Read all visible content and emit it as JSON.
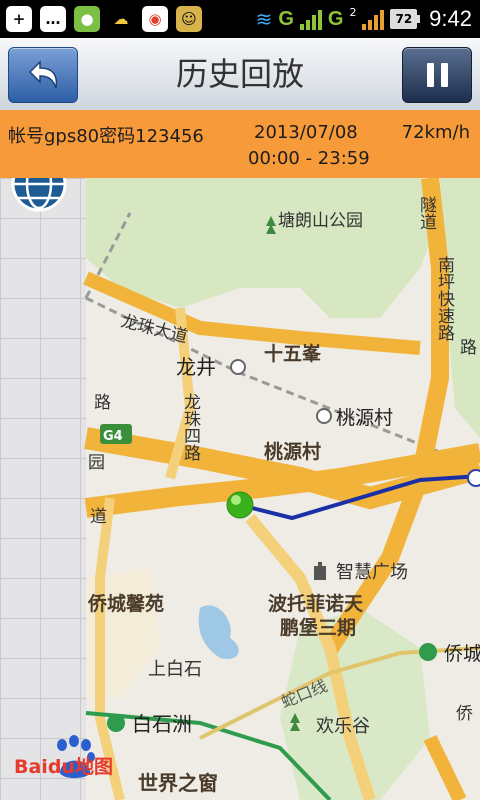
{
  "status_bar": {
    "left_icons": [
      "add-notification-icon",
      "chat-icon",
      "microphone-icon",
      "weather-icon",
      "browser-icon",
      "app-robot-icon"
    ],
    "network1": "G",
    "network2": "G",
    "sim2_label": "2",
    "battery": "72",
    "time": "9:42"
  },
  "header": {
    "title": "历史回放",
    "back_icon": "back-arrow-icon",
    "pause_icon": "pause-icon"
  },
  "info": {
    "account": "帐号gps80密码123456",
    "date": "2013/07/08",
    "speed": "72km/h",
    "time_range": "00:00 - 23:59"
  },
  "map": {
    "labels": {
      "longzhu_ave": "龙珠大道",
      "longzhu_4": "龙珠四路",
      "longjing": "龙井",
      "shiwufeng": "十五峯",
      "taoyuancun_station": "桃源村",
      "taoyuancun_area": "桃源村",
      "tanglangshan": "塘朗山公园",
      "nanping": "南坪快速路",
      "tunnel": "隧道",
      "road_lu": "路",
      "g4": "G4",
      "zhihui": "智慧广场",
      "qiaocheng_xinyuan": "侨城馨苑",
      "bosuofeinuotian": "波托菲诺天",
      "pengbaosanqi": "鹏堡三期",
      "qiaocheng": "侨城",
      "shangbaishi": "上白石",
      "baishizhou": "白石洲",
      "shekou_line": "蛇口线",
      "huanlegu": "欢乐谷",
      "shijiezhichuang": "世界之窗",
      "road_dao": "道",
      "road_yuan": "园",
      "qiao": "侨",
      "road_fragment": "路"
    },
    "baidu_logo": "Baidu地图",
    "colors": {
      "route": "#1b2fa6",
      "highway": "#f1b33a",
      "metro": "#2e9c4c",
      "start_marker": "#3ab01d",
      "park": "#cfe3b6"
    }
  }
}
